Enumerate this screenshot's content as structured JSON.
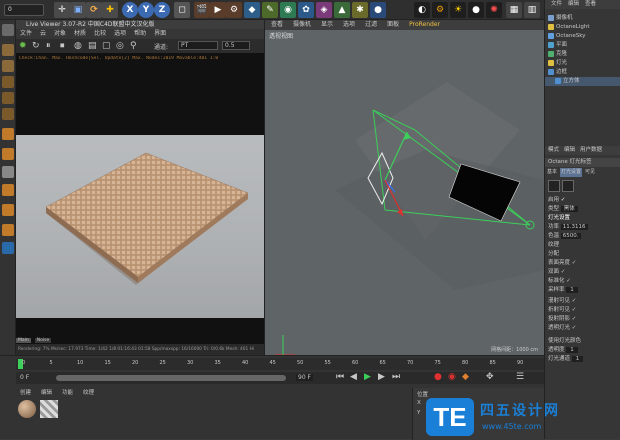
{
  "topbar": {
    "mode_field": "0",
    "tool_buttons": [
      "X",
      "Y",
      "Z"
    ]
  },
  "live_viewer": {
    "title": "Live Viewer 3.07-R2 中国C4D联盟中文汉化版",
    "menu": [
      "文件",
      "云",
      "对象",
      "材质",
      "比较",
      "选项",
      "帮助",
      "界面"
    ],
    "channel_label": "通道:",
    "channel_value": "PT",
    "zoom_value": "0.5",
    "info_line": "Check:Chan. Max. Hashcode|Sel. Update[2] Max. Nodes:2019 Movable:401 1:0",
    "status_line": "Rendering: 7%   Ms/sec: 17.973   Time: 1/42  1/8  01:16:43  01:58  Spp/maxspp: 16/16000  Tri: 0/0.6k  Mesh: 401 Hi",
    "tabs": [
      "Main",
      "Noise"
    ]
  },
  "viewport": {
    "menu": [
      "查看",
      "摄像机",
      "显示",
      "选项",
      "过滤",
      "面板",
      "ProRender"
    ],
    "label": "透视视图",
    "grid_label": "网格间距：1000 cm"
  },
  "right_panel": {
    "menu": [
      "文件",
      "编辑",
      "查看"
    ],
    "objects": [
      "摄像机",
      "OctaneLight",
      "OctaneSky",
      "平面",
      "克隆",
      "灯光",
      "边框",
      "立方体"
    ],
    "attr_tabs": [
      "模式",
      "编辑",
      "用户数据"
    ],
    "attr_header": "Octane 灯光标签",
    "sub_tabs": [
      "基本",
      "灯光设置",
      "可见"
    ],
    "fields": [
      {
        "label": "启用",
        "value": "✓"
      },
      {
        "label": "类型",
        "value": "黑体"
      },
      {
        "label": "灯光设置",
        "value": ""
      },
      {
        "label": "功率",
        "value": "11.3116"
      },
      {
        "label": "色温",
        "value": "6500."
      },
      {
        "label": "纹理",
        "value": ""
      },
      {
        "label": "分配",
        "value": ""
      },
      {
        "label": "表面亮度",
        "value": "✓"
      },
      {
        "label": "双面",
        "value": "✓"
      },
      {
        "label": "标准化",
        "value": "✓"
      },
      {
        "label": "采样率",
        "value": "1"
      },
      {
        "label": "漫射可见",
        "value": "✓"
      },
      {
        "label": "折射可见",
        "value": "✓"
      },
      {
        "label": "投射阴影",
        "value": "✓"
      },
      {
        "label": "透明灯光",
        "value": "✓"
      },
      {
        "label": "使用灯光颜色",
        "value": ""
      },
      {
        "label": "透明度",
        "value": "1"
      },
      {
        "label": "灯光通道",
        "value": "1"
      }
    ]
  },
  "timeline": {
    "ticks": [
      "0",
      "5",
      "10",
      "15",
      "20",
      "25",
      "30",
      "35",
      "40",
      "45",
      "50",
      "55",
      "60",
      "65",
      "70",
      "75",
      "80",
      "85",
      "90"
    ],
    "frame": "0 F",
    "end": "90 F"
  },
  "materials": {
    "tabs": [
      "创建",
      "编辑",
      "功能",
      "纹理"
    ]
  },
  "bottom_right": {
    "label1": "位置",
    "label2": "X",
    "label3": "Y"
  },
  "watermark": {
    "logo": "TE",
    "cn": "四五设计网",
    "url": "www.45te.com"
  }
}
